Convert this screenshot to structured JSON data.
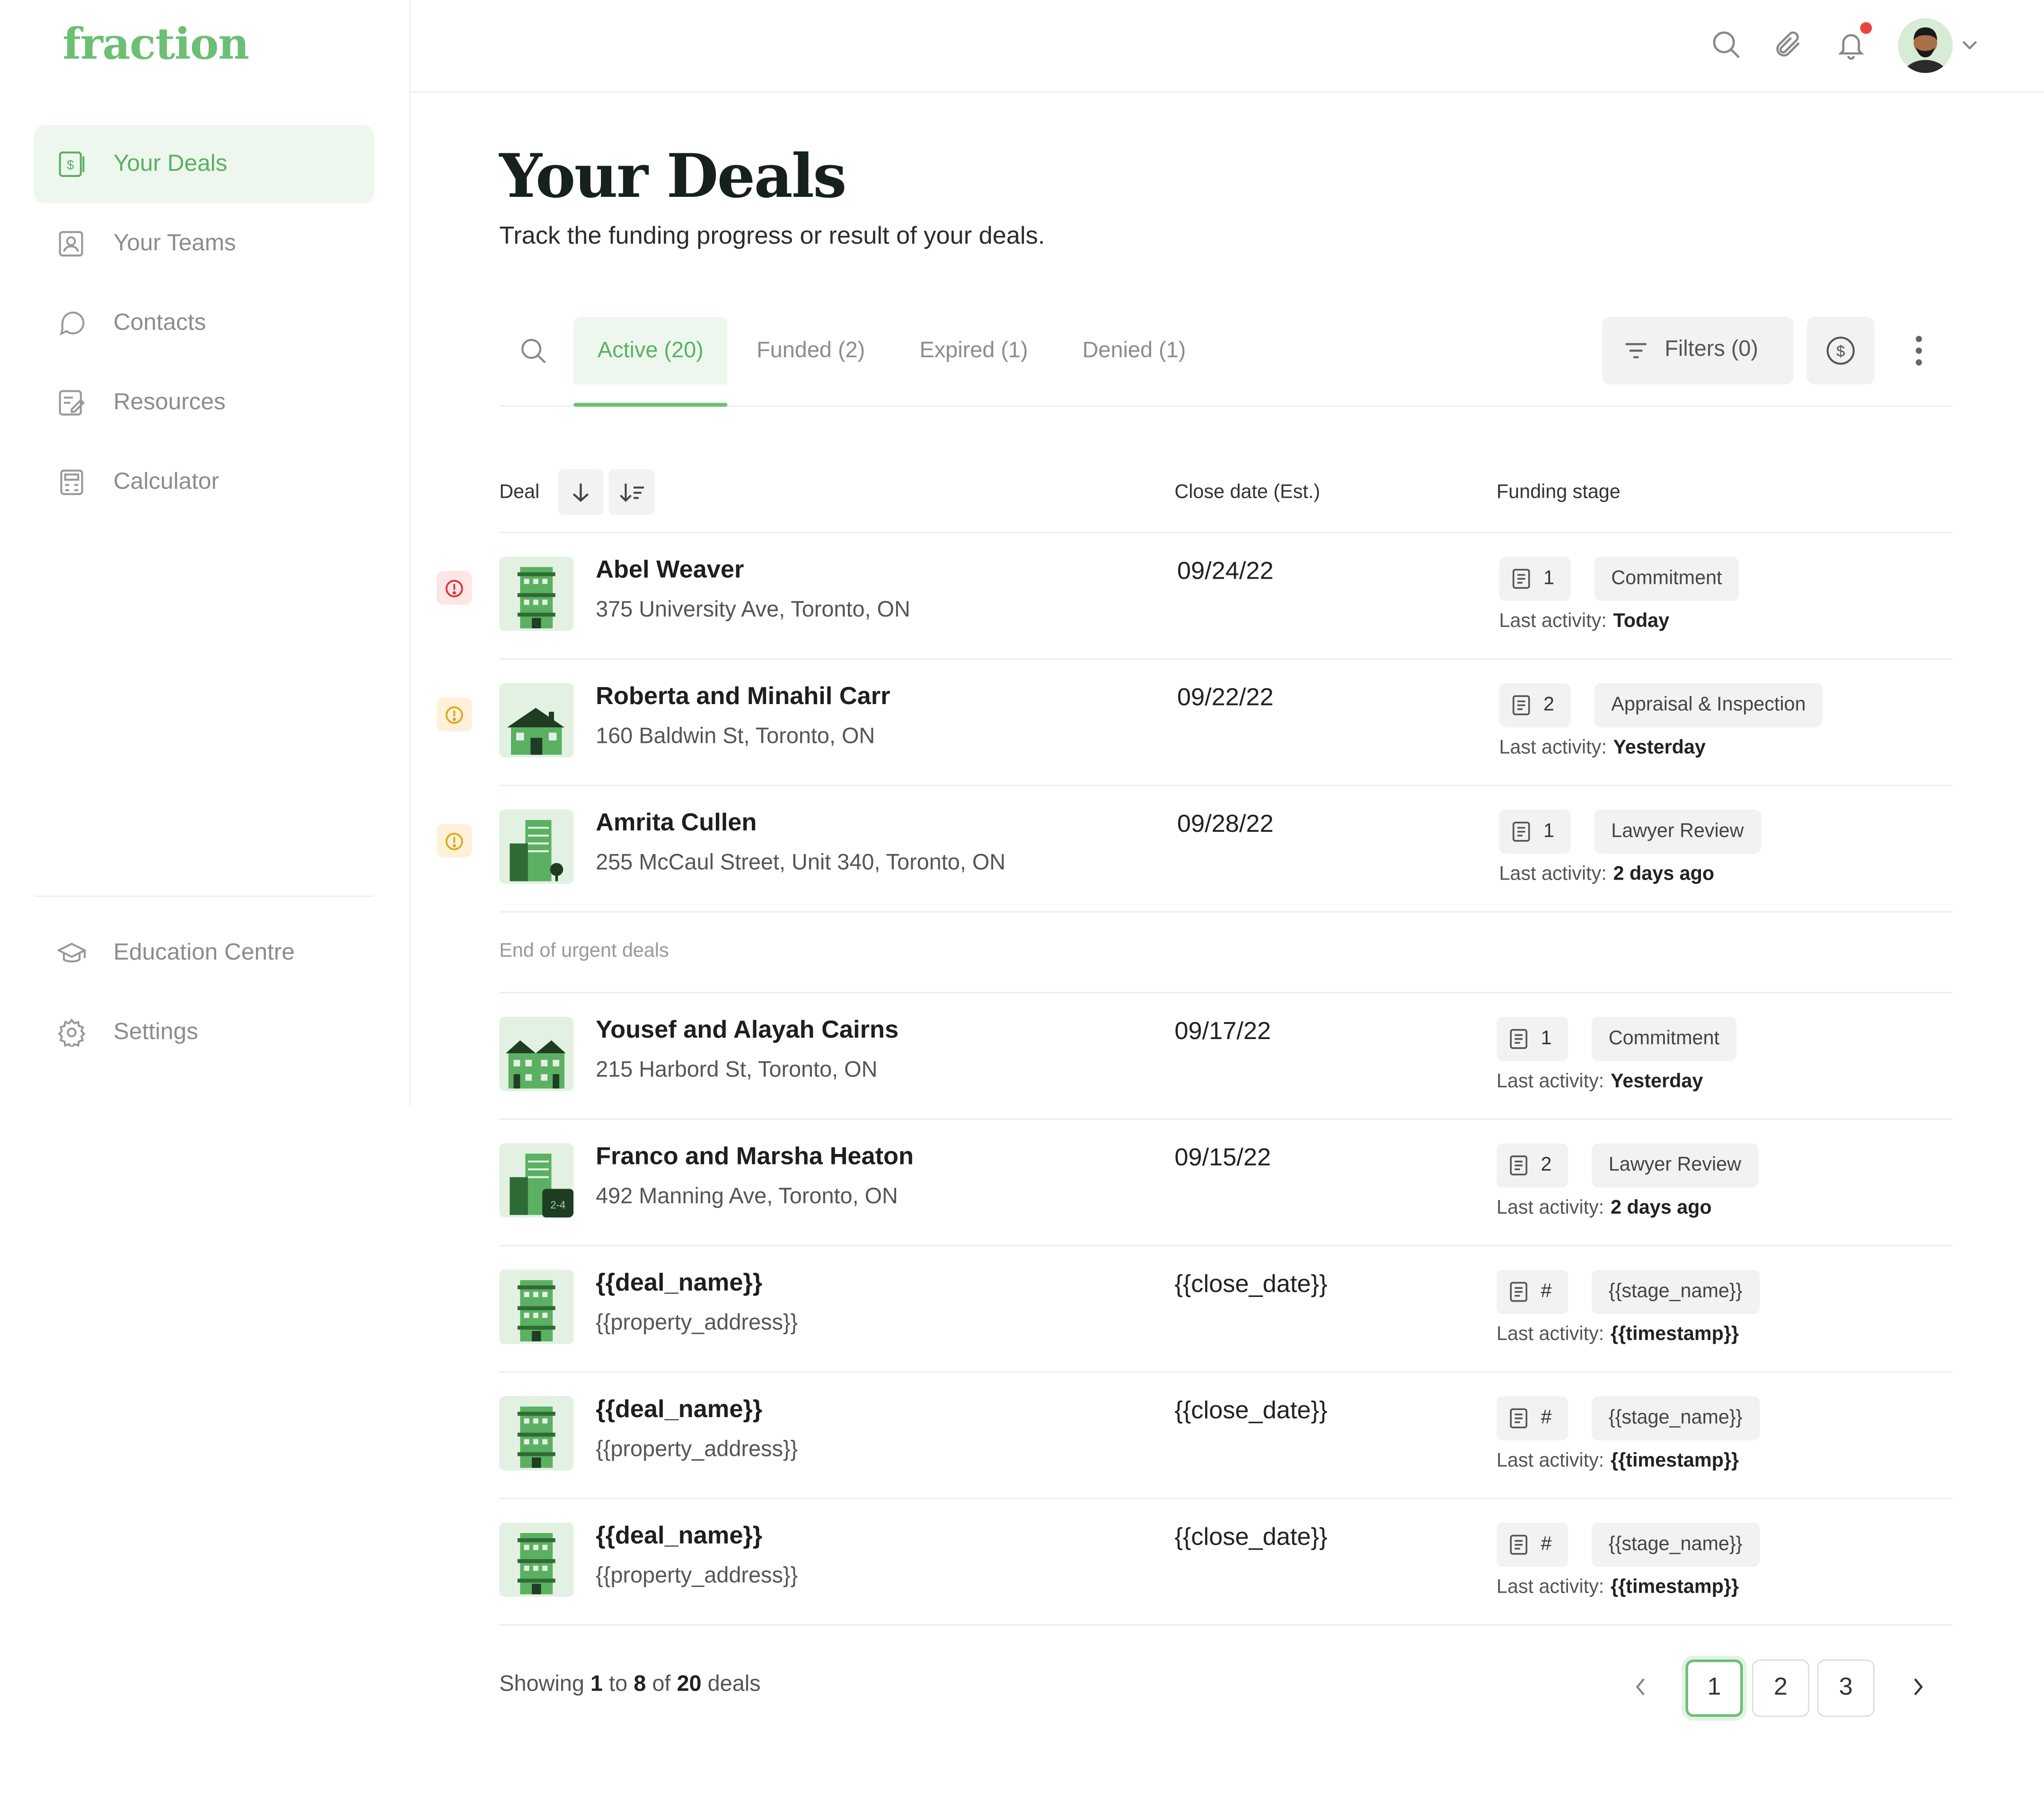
{
  "brand": {
    "logo_text": "fraction",
    "accent": "#6cbf74"
  },
  "sidebar": {
    "items": [
      {
        "label": "Your Deals",
        "icon": "dollar-document-icon",
        "active": true
      },
      {
        "label": "Your Teams",
        "icon": "team-badge-icon"
      },
      {
        "label": "Contacts",
        "icon": "chat-bubble-icon"
      },
      {
        "label": "Resources",
        "icon": "edit-document-icon"
      },
      {
        "label": "Calculator",
        "icon": "calculator-icon"
      }
    ],
    "bottom_items": [
      {
        "label": "Education Centre",
        "icon": "graduation-cap-icon"
      },
      {
        "label": "Settings",
        "icon": "gear-icon"
      }
    ]
  },
  "header": {
    "icons": [
      "search-icon",
      "paperclip-icon",
      "bell-icon",
      "avatar",
      "chevron-down-icon"
    ]
  },
  "page": {
    "title": "Your Deals",
    "subtitle": "Track the funding progress or result of your deals."
  },
  "tabs": [
    {
      "label": "Active (20)",
      "active": true
    },
    {
      "label": "Funded (2)"
    },
    {
      "label": "Expired (1)"
    },
    {
      "label": "Denied (1)"
    }
  ],
  "toolbar": {
    "filters_label": "Filters (0)"
  },
  "table": {
    "headers": {
      "deal": "Deal",
      "close_date": "Close date (Est.)",
      "funding_stage": "Funding stage"
    },
    "activity_label": "Last activity:",
    "urgent_rows": [
      {
        "name": "Abel Weaver",
        "address": "375 University Ave, Toronto, ON",
        "close_date": "09/24/22",
        "doc_count": "1",
        "stage": "Commitment",
        "last_activity": "Today",
        "alert": "red"
      },
      {
        "name": "Roberta and Minahil Carr",
        "address": "160 Baldwin St, Toronto, ON",
        "close_date": "09/22/22",
        "doc_count": "2",
        "stage": "Appraisal & Inspection",
        "last_activity": "Yesterday",
        "alert": "yellow"
      },
      {
        "name": "Amrita Cullen",
        "address": "255 McCaul Street, Unit 340, Toronto, ON",
        "close_date": "09/28/22",
        "doc_count": "1",
        "stage": "Lawyer Review",
        "last_activity": "2 days ago",
        "alert": "yellow"
      }
    ],
    "urgent_end_label": "End of urgent deals",
    "rows": [
      {
        "name": "Yousef and Alayah Cairns",
        "address": "215 Harbord St, Toronto, ON",
        "close_date": "09/17/22",
        "doc_count": "1",
        "stage": "Commitment",
        "last_activity": "Yesterday"
      },
      {
        "name": "Franco and Marsha Heaton",
        "address": "492 Manning Ave, Toronto, ON",
        "close_date": "09/15/22",
        "doc_count": "2",
        "stage": "Lawyer Review",
        "last_activity": "2 days ago",
        "thumb_badge": "2-4"
      },
      {
        "name": "{{deal_name}}",
        "address": "{{property_address}}",
        "close_date": "{{close_date}}",
        "doc_count": "#",
        "stage": "{{stage_name}}",
        "last_activity": "{{timestamp}}"
      },
      {
        "name": "{{deal_name}}",
        "address": "{{property_address}}",
        "close_date": "{{close_date}}",
        "doc_count": "#",
        "stage": "{{stage_name}}",
        "last_activity": "{{timestamp}}"
      },
      {
        "name": "{{deal_name}}",
        "address": "{{property_address}}",
        "close_date": "{{close_date}}",
        "doc_count": "#",
        "stage": "{{stage_name}}",
        "last_activity": "{{timestamp}}"
      }
    ]
  },
  "pagination": {
    "showing_prefix": "Showing",
    "from": "1",
    "to_word": "to",
    "to": "8",
    "of_word": "of",
    "total": "20",
    "suffix": "deals",
    "pages": [
      "1",
      "2",
      "3"
    ],
    "current": "1"
  }
}
